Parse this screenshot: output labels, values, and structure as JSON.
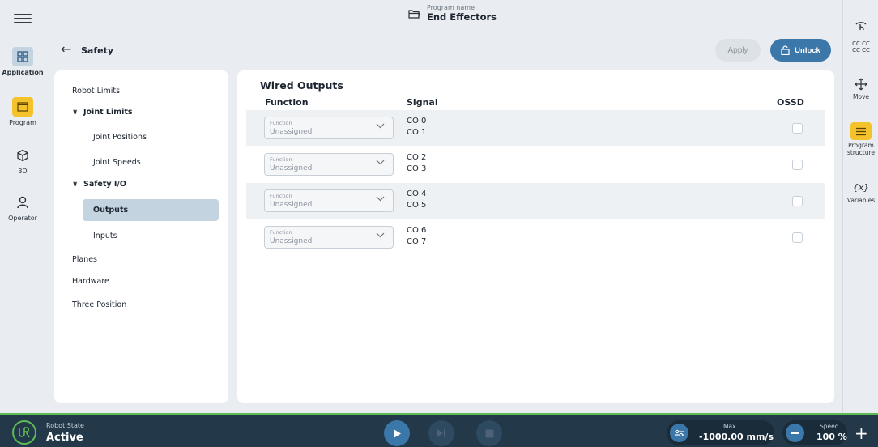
{
  "header": {
    "program_label": "Program name",
    "program_name": "End Effectors"
  },
  "left_rail": {
    "items": [
      {
        "label": "Application",
        "icon": "grid-icon"
      },
      {
        "label": "Program",
        "icon": "program-window-icon"
      },
      {
        "label": "3D",
        "icon": "cube-icon"
      },
      {
        "label": "Operator",
        "icon": "person-icon"
      }
    ]
  },
  "right_rail": {
    "items": [
      {
        "label": "",
        "icon": "hand-gesture-icon"
      },
      {
        "label": "CC CC\nCC CC",
        "icon": ""
      },
      {
        "label": "Move",
        "icon": "move-arrows-icon"
      },
      {
        "label": "Program structure",
        "icon": "list-icon"
      },
      {
        "label": "Variables",
        "icon": "variables-icon"
      }
    ]
  },
  "title_bar": {
    "title": "Safety",
    "apply_label": "Apply",
    "unlock_label": "Unlock"
  },
  "nav": {
    "robot_limits": "Robot Limits",
    "joint_limits": "Joint Limits",
    "joint_positions": "Joint Positions",
    "joint_speeds": "Joint Speeds",
    "safety_io": "Safety I/O",
    "outputs": "Outputs",
    "inputs": "Inputs",
    "planes": "Planes",
    "hardware": "Hardware",
    "three_position": "Three Position"
  },
  "content": {
    "section_title": "Wired Outputs",
    "columns": {
      "function": "Function",
      "signal": "Signal",
      "ossd": "OSSD"
    },
    "rows": [
      {
        "function_caption": "Function",
        "function_value": "Unassigned",
        "signal_a": "CO 0",
        "signal_b": "CO 1",
        "ossd": false
      },
      {
        "function_caption": "Function",
        "function_value": "Unassigned",
        "signal_a": "CO 2",
        "signal_b": "CO 3",
        "ossd": false
      },
      {
        "function_caption": "Function",
        "function_value": "Unassigned",
        "signal_a": "CO 4",
        "signal_b": "CO 5",
        "ossd": false
      },
      {
        "function_caption": "Function",
        "function_value": "Unassigned",
        "signal_a": "CO 6",
        "signal_b": "CO 7",
        "ossd": false
      }
    ]
  },
  "bottom_bar": {
    "robot_state_label": "Robot State",
    "robot_state": "Active",
    "max_label": "Max",
    "max_value": "-1000.00 mm/s",
    "speed_label": "Speed",
    "speed_value": "100 %",
    "accent_color": "#5dbb55"
  }
}
